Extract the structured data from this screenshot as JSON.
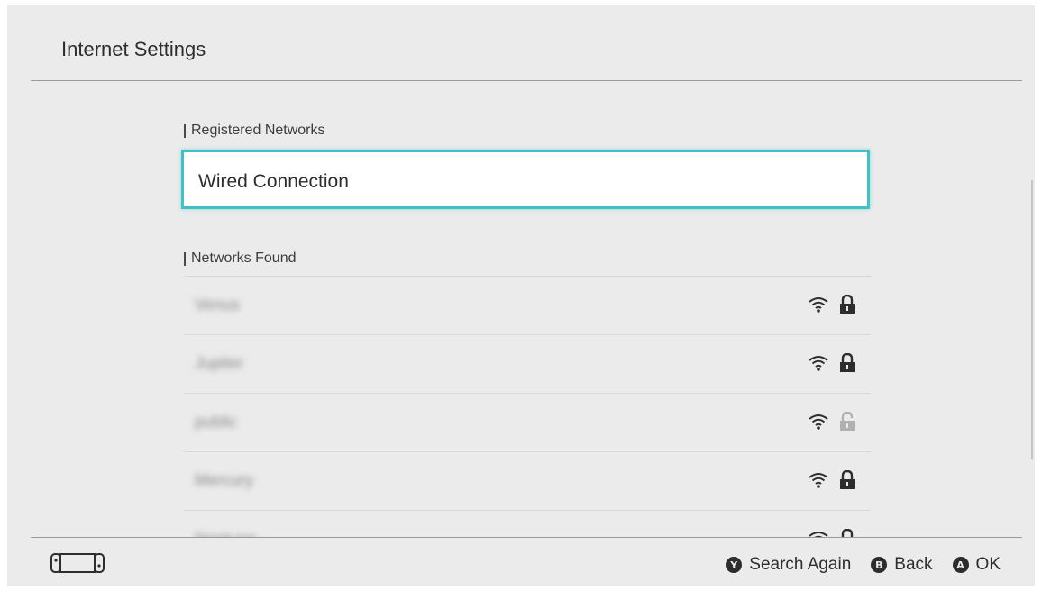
{
  "header": {
    "title": "Internet Settings"
  },
  "registered": {
    "label": "Registered Networks",
    "items": [
      {
        "name": "Wired Connection"
      }
    ]
  },
  "found": {
    "label": "Networks Found",
    "networks": [
      {
        "name": "Venus",
        "icon_signal": "wifi-icon",
        "icon_lock": "lock-icon",
        "secured": true
      },
      {
        "name": "Jupiter",
        "icon_signal": "wifi-icon",
        "icon_lock": "lock-icon",
        "secured": true
      },
      {
        "name": "public",
        "icon_signal": "wifi-icon",
        "icon_lock": "lock-open-icon",
        "secured": false
      },
      {
        "name": "Mercury",
        "icon_signal": "wifi-icon",
        "icon_lock": "lock-icon",
        "secured": true
      },
      {
        "name": "Neptune",
        "icon_signal": "wifi-icon",
        "icon_lock": "lock-icon",
        "secured": true
      }
    ]
  },
  "footer": {
    "controller_icon": "handheld-console-icon",
    "actions": [
      {
        "glyph": "Y",
        "label": "Search Again",
        "icon": "y-button-icon"
      },
      {
        "glyph": "B",
        "label": "Back",
        "icon": "b-button-icon"
      },
      {
        "glyph": "A",
        "label": "OK",
        "icon": "a-button-icon"
      }
    ]
  },
  "colors": {
    "accent": "#3fc2c6",
    "background": "#ebebeb",
    "text": "#2d2d2d"
  }
}
